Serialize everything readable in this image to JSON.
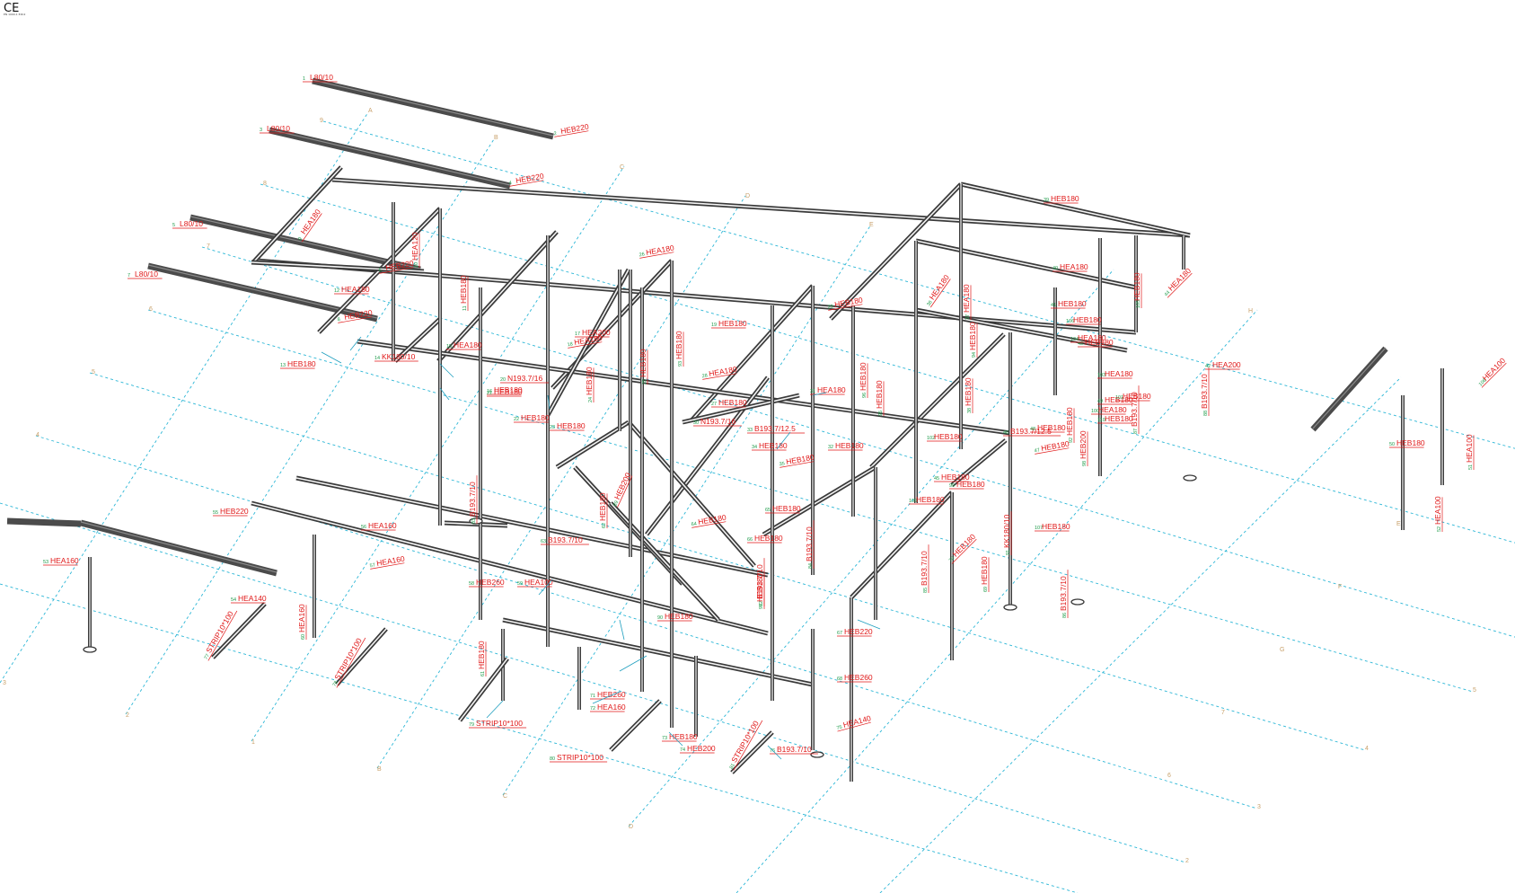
{
  "mark": {
    "symbol": "CE",
    "caption": "EN 1090-1 EXC2"
  },
  "grid_labels": [
    "A",
    "B",
    "C",
    "D",
    "E",
    "H",
    "9",
    "8",
    "7",
    "6",
    "5",
    "4",
    "3",
    "2",
    "1",
    "B",
    "C",
    "D",
    "E",
    "F",
    "G",
    "7",
    "6",
    "5",
    "4",
    "3",
    "2"
  ],
  "labels": [
    "L80/10",
    "HEB220",
    "L80/10",
    "HEB220",
    "L80/10",
    "HEB220",
    "L80/10",
    "HEB220",
    "HEA180",
    "HEA120",
    "HEB180",
    "HEA180",
    "HEB180",
    "KK180/10",
    "HEA180",
    "HEB180",
    "HEA200",
    "HEA180",
    "HEB180",
    "N193.7/16",
    "HEB180",
    "HEB180",
    "HEB180",
    "HEB180",
    "HEB180",
    "HEA180",
    "HEB180",
    "HEA180",
    "HEB180",
    "N193.7/16",
    "HEA180",
    "HEB180",
    "B193.7/12.5",
    "HEB180",
    "HEB180",
    "HEA180",
    "HEA180",
    "HEB180",
    "HEB180",
    "HEA180",
    "HEB180",
    "HEA200",
    "HEB180",
    "HEA180",
    "HEB180",
    "B193.7/12.5",
    "HEB180",
    "HEB180",
    "HEB180",
    "HEB180",
    "HEA100",
    "HEA100",
    "HEA160",
    "HEA140",
    "HEB220",
    "HEA160",
    "HEA160",
    "HEB260",
    "HEA100",
    "HEA160",
    "HEB180",
    "HEB180",
    "B193.7/10",
    "HEB180",
    "HEB180",
    "HEB180",
    "HEB220",
    "HEB260",
    "HEB180",
    "HEB180",
    "HEB260",
    "HEA160",
    "HEB180",
    "HEB200",
    "HEA140",
    "B193.7/10",
    "STRIP10*100",
    "STRIP10*100",
    "STRIP10*100",
    "STRIP10*100",
    "STRIP10*100",
    "B193.7/10",
    "B193.7/10",
    "B193.7/10",
    "B193.7/10",
    "B193.7/10",
    "B193.7/10",
    "B193.7/10",
    "HEB200",
    "HEB180",
    "KK180/10",
    "HEB180",
    "HEB180",
    "HEB180",
    "HEB180",
    "HEB180",
    "HEB180",
    "HEB200",
    "HEB180",
    "HEA180",
    "HEB180",
    "HEB180",
    "HEA180",
    "HEA180",
    "HEB180",
    "HEB180",
    "HEB180",
    "HEA100",
    "HEB180",
    "HEB180"
  ]
}
